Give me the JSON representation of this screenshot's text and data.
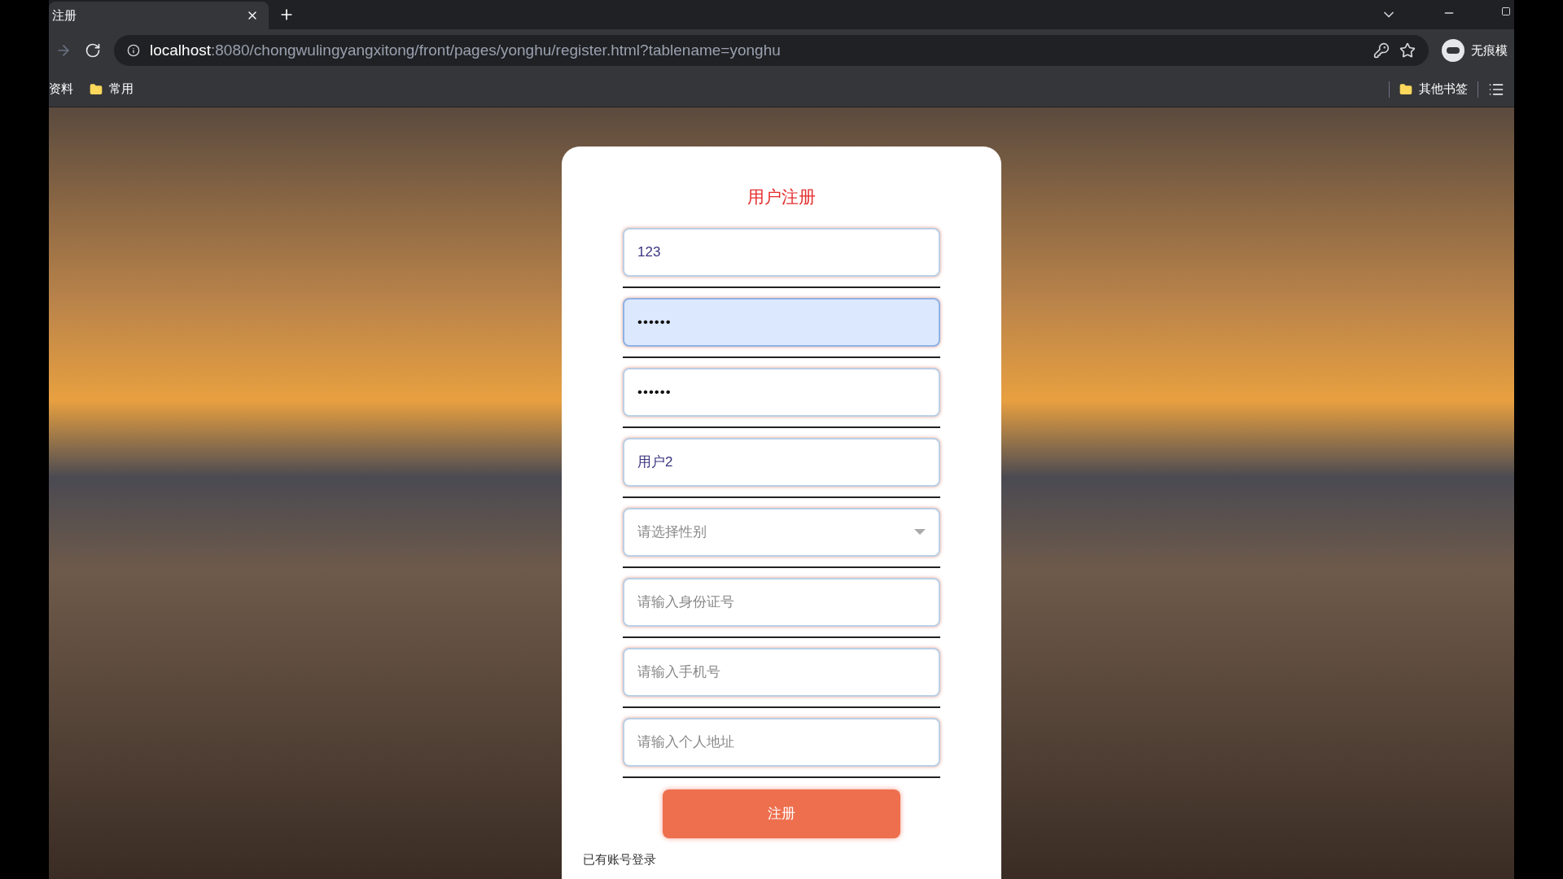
{
  "browser": {
    "tab_title": "注册",
    "url_host": "localhost",
    "url_rest": ":8080/chongwulingyangxitong/front/pages/yonghu/register.html?tablename=yonghu",
    "profile_label": "无痕模",
    "bookmarks": [
      {
        "label": "资料",
        "kind": "text"
      },
      {
        "label": "常用",
        "kind": "folder"
      }
    ],
    "other_bookmarks": "其他书签"
  },
  "form": {
    "title": "用户注册",
    "fields": [
      {
        "kind": "text",
        "value": "123",
        "highlighted": false
      },
      {
        "kind": "password",
        "value": "••••••",
        "highlighted": true
      },
      {
        "kind": "password",
        "value": "••••••",
        "highlighted": false
      },
      {
        "kind": "text",
        "value": "用户2",
        "highlighted": false
      },
      {
        "kind": "select",
        "placeholder": "请选择性别",
        "highlighted": false
      },
      {
        "kind": "text",
        "placeholder": "请输入身份证号",
        "highlighted": false
      },
      {
        "kind": "text",
        "placeholder": "请输入手机号",
        "highlighted": false
      },
      {
        "kind": "text",
        "placeholder": "请输入个人地址",
        "highlighted": false
      }
    ],
    "submit": "注册",
    "login_link": "已有账号登录"
  }
}
